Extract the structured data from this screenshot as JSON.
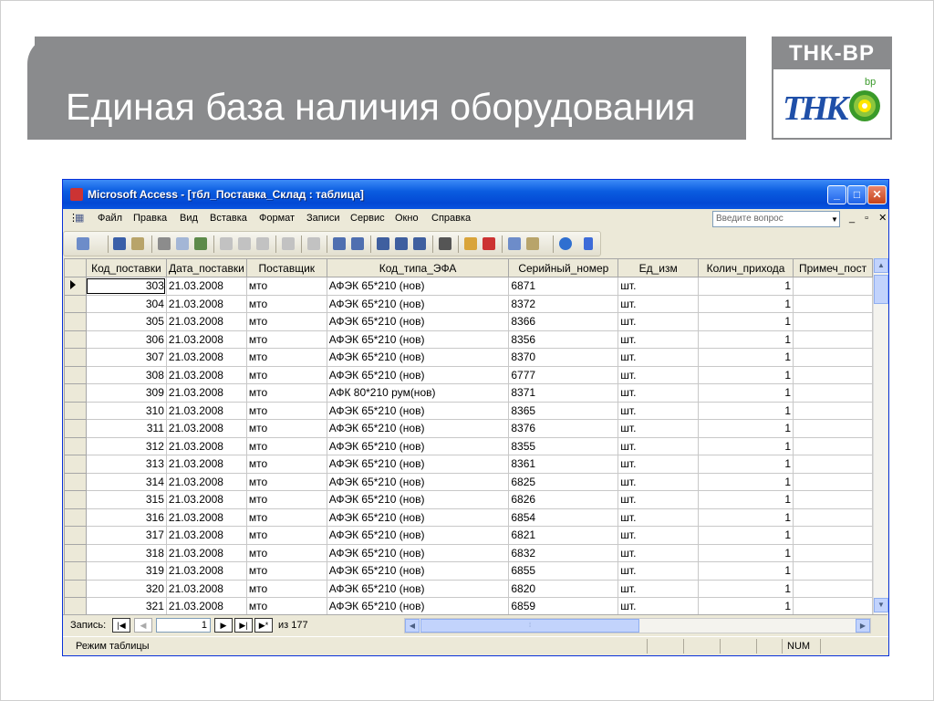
{
  "slide": {
    "title": "Единая база наличия оборудования",
    "logo_top": "ТНК-BP",
    "logo_mark": "ТНК",
    "logo_bp": "bp"
  },
  "window": {
    "title": "Microsoft Access - [тбл_Поставка_Склад : таблица]",
    "menu": [
      "Файл",
      "Правка",
      "Вид",
      "Вставка",
      "Формат",
      "Записи",
      "Сервис",
      "Окно",
      "Справка"
    ],
    "ask_placeholder": "Введите вопрос",
    "mdi_buttons": "_ ▫ ✕"
  },
  "table": {
    "columns": [
      "Код_поставки",
      "Дата_поставки",
      "Поставщик",
      "Код_типа_ЭФА",
      "Серийный_номер",
      "Ед_изм",
      "Колич_прихода",
      "Примеч_пост"
    ],
    "rows": [
      [
        "303",
        "21.03.2008",
        "мто",
        "АФЭК 65*210 (нов)",
        "6871",
        "шт.",
        "1",
        ""
      ],
      [
        "304",
        "21.03.2008",
        "мто",
        "АФЭК 65*210 (нов)",
        "8372",
        "шт.",
        "1",
        ""
      ],
      [
        "305",
        "21.03.2008",
        "мто",
        "АФЭК 65*210 (нов)",
        "8366",
        "шт.",
        "1",
        ""
      ],
      [
        "306",
        "21.03.2008",
        "мто",
        "АФЭК 65*210 (нов)",
        "8356",
        "шт.",
        "1",
        ""
      ],
      [
        "307",
        "21.03.2008",
        "мто",
        "АФЭК 65*210 (нов)",
        "8370",
        "шт.",
        "1",
        ""
      ],
      [
        "308",
        "21.03.2008",
        "мто",
        "АФЭК 65*210 (нов)",
        "6777",
        "шт.",
        "1",
        ""
      ],
      [
        "309",
        "21.03.2008",
        "мто",
        "АФК 80*210 рум(нов)",
        "8371",
        "шт.",
        "1",
        ""
      ],
      [
        "310",
        "21.03.2008",
        "мто",
        "АФЭК 65*210 (нов)",
        "8365",
        "шт.",
        "1",
        ""
      ],
      [
        "311",
        "21.03.2008",
        "мто",
        "АФЭК 65*210 (нов)",
        "8376",
        "шт.",
        "1",
        ""
      ],
      [
        "312",
        "21.03.2008",
        "мто",
        "АФЭК 65*210 (нов)",
        "8355",
        "шт.",
        "1",
        ""
      ],
      [
        "313",
        "21.03.2008",
        "мто",
        "АФЭК 65*210 (нов)",
        "8361",
        "шт.",
        "1",
        ""
      ],
      [
        "314",
        "21.03.2008",
        "мто",
        "АФЭК 65*210 (нов)",
        "6825",
        "шт.",
        "1",
        ""
      ],
      [
        "315",
        "21.03.2008",
        "мто",
        "АФЭК 65*210 (нов)",
        "6826",
        "шт.",
        "1",
        ""
      ],
      [
        "316",
        "21.03.2008",
        "мто",
        "АФЭК 65*210 (нов)",
        "6854",
        "шт.",
        "1",
        ""
      ],
      [
        "317",
        "21.03.2008",
        "мто",
        "АФЭК 65*210 (нов)",
        "6821",
        "шт.",
        "1",
        ""
      ],
      [
        "318",
        "21.03.2008",
        "мто",
        "АФЭК 65*210 (нов)",
        "6832",
        "шт.",
        "1",
        ""
      ],
      [
        "319",
        "21.03.2008",
        "мто",
        "АФЭК 65*210 (нов)",
        "6855",
        "шт.",
        "1",
        ""
      ],
      [
        "320",
        "21.03.2008",
        "мто",
        "АФЭК 65*210 (нов)",
        "6820",
        "шт.",
        "1",
        ""
      ],
      [
        "321",
        "21.03.2008",
        "мто",
        "АФЭК 65*210 (нов)",
        "6859",
        "шт.",
        "1",
        ""
      ]
    ]
  },
  "navigation": {
    "label": "Запись:",
    "current": "1",
    "total": "из 177"
  },
  "status": {
    "mode": "Режим таблицы",
    "num": "NUM"
  }
}
